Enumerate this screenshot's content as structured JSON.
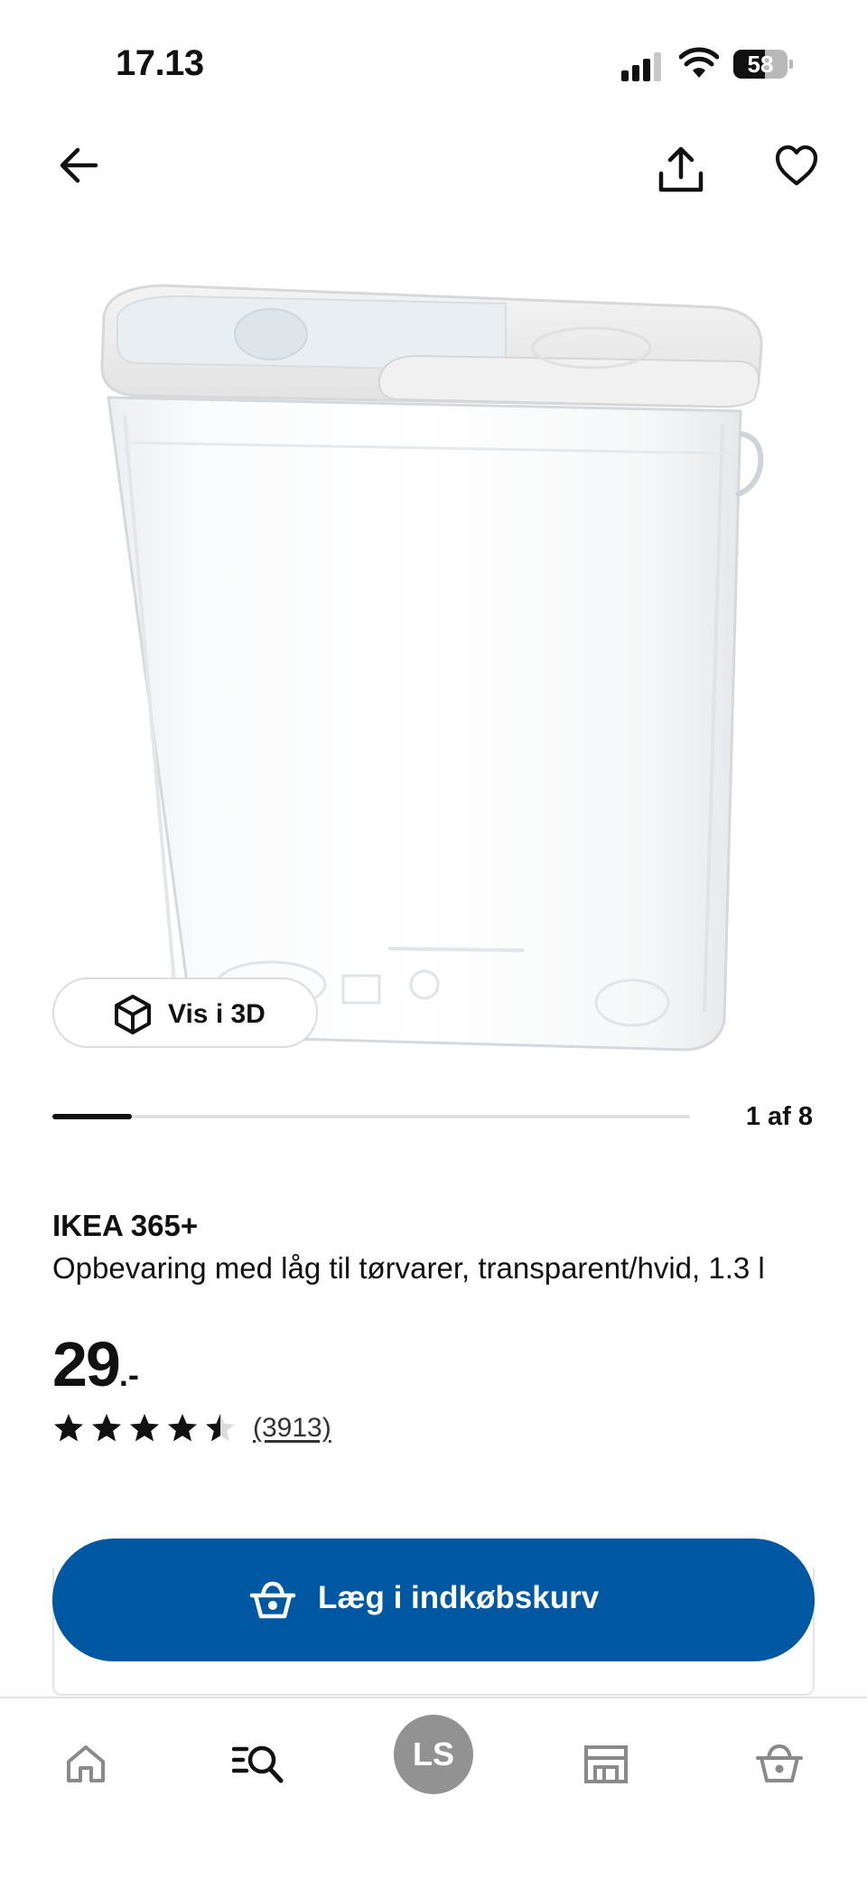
{
  "status_bar": {
    "time": "17.13",
    "battery": "58",
    "battery_level": 0.58
  },
  "nav": {
    "back_icon": "arrow-left-icon",
    "share_icon": "share-icon",
    "favorite_icon": "heart-icon"
  },
  "gallery": {
    "view_3d_label": "Vis i 3D",
    "position_text": "1 af 8",
    "current": 1,
    "total": 8
  },
  "product": {
    "name": "IKEA 365+",
    "description": "Opbevaring med låg til tørvarer, transparent/hvid, 1.3 l",
    "price": "29",
    "price_suffix": ".-",
    "rating": 4.5,
    "review_count": "(3913)"
  },
  "actions": {
    "add_to_cart_label": "Læg i indkøbskurv",
    "button_color": "#0058a3"
  },
  "tabbar": {
    "items": [
      {
        "name": "home-icon"
      },
      {
        "name": "search-icon"
      },
      {
        "name": "profile-avatar",
        "initials": "LS"
      },
      {
        "name": "store-icon"
      },
      {
        "name": "basket-icon"
      }
    ]
  }
}
